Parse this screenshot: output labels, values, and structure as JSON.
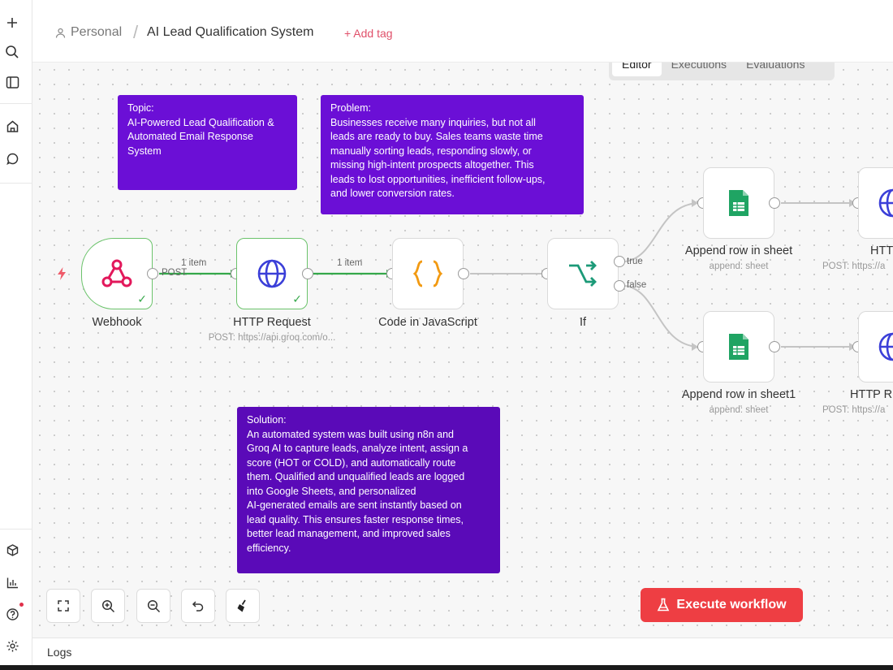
{
  "header": {
    "breadcrumb_project": "Personal",
    "workflow_title": "AI Lead Qualification System",
    "add_tag_label": "+ Add tag"
  },
  "tabs": [
    {
      "label": "Editor",
      "active": true
    },
    {
      "label": "Executions",
      "active": false
    },
    {
      "label": "Evaluations",
      "active": false
    }
  ],
  "notes": {
    "topic": "Topic:\nAI-Powered Lead Qualification &\nAutomated Email Response\nSystem",
    "problem": "Problem:\nBusinesses receive many inquiries, but not all\nleads are ready to buy. Sales teams waste time\nmanually sorting leads, responding slowly, or\nmissing high-intent prospects altogether. This\nleads to lost opportunities, inefficient follow-ups,\nand lower conversion rates.",
    "solution": "Solution:\nAn automated system was built using n8n and\nGroq AI to capture leads, analyze intent, assign a\nscore (HOT or COLD), and automatically route\nthem. Qualified and unqualified leads are logged\ninto Google Sheets, and personalized\nAI-generated emails are sent instantly based on\nlead quality. This ensures faster response times,\nbetter lead management, and improved sales\nefficiency."
  },
  "nodes": {
    "webhook": {
      "label": "Webhook",
      "output_label": "POST"
    },
    "http_request": {
      "label": "HTTP Request",
      "subtitle": "POST: https://api.groq.com/o..."
    },
    "code": {
      "label": "Code in JavaScript"
    },
    "if": {
      "label": "If",
      "true_label": "true",
      "false_label": "false"
    },
    "append_row": {
      "label": "Append row in sheet",
      "subtitle": "append: sheet"
    },
    "append_row1": {
      "label": "Append row in sheet1",
      "subtitle": "append: sheet"
    },
    "http_r_top": {
      "label": "HTTP R",
      "subtitle": "POST: https://a"
    },
    "http_r_bottom": {
      "label": "HTTP R",
      "subtitle": "POST: https://a"
    }
  },
  "edges": {
    "webhook_to_http": "1 item",
    "http_to_code": "1 item"
  },
  "controls": {
    "execute_label": "Execute workflow",
    "logs_label": "Logs"
  },
  "colors": {
    "note_purple": "#6b0fd6",
    "note_purple_dark": "#5a0ab8",
    "success_green": "#35a84a",
    "execute_red": "#ee3e43",
    "accent_pink": "#e0506a"
  }
}
